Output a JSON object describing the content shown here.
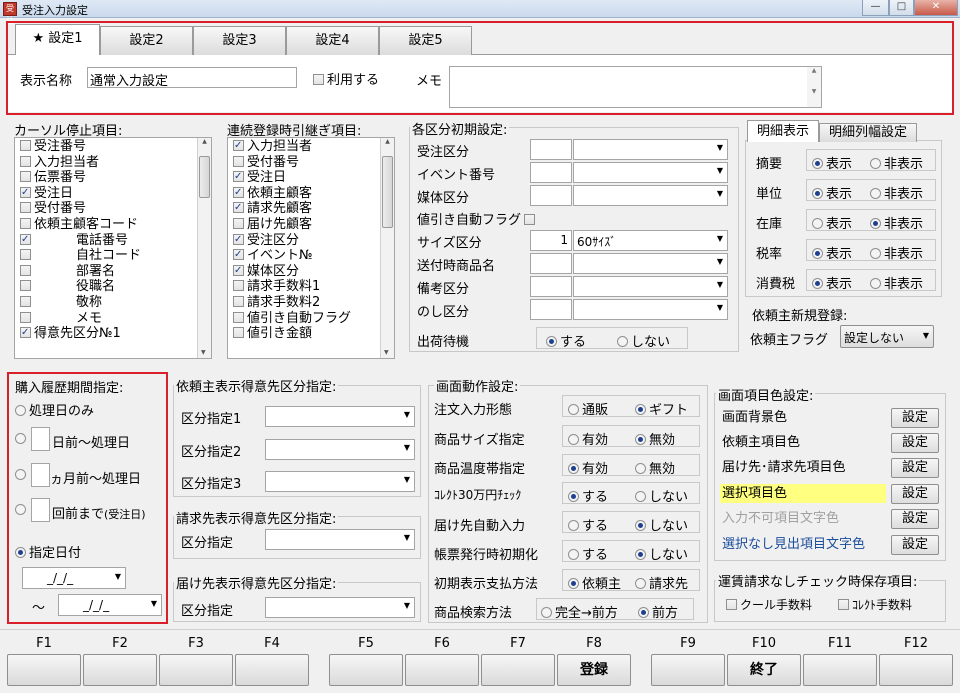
{
  "window": {
    "title": "受注入力設定",
    "app_icon": "受注",
    "buttons": [
      "—",
      "□",
      "✕"
    ]
  },
  "tabs": [
    {
      "label": "★ 設定1"
    },
    {
      "label": "設定2"
    },
    {
      "label": "設定3"
    },
    {
      "label": "設定4"
    },
    {
      "label": "設定5"
    }
  ],
  "settings": {
    "name_label": "表示名称",
    "name_value": "通常入力設定",
    "use_label": "利用する",
    "memo_label": "メモ"
  },
  "cursor": {
    "title": "カーソル停止項目:",
    "items": [
      {
        "label": "受注番号",
        "checked": false
      },
      {
        "label": "入力担当者",
        "checked": false
      },
      {
        "label": "伝票番号",
        "checked": false
      },
      {
        "label": "受注日",
        "checked": true
      },
      {
        "label": "受付番号",
        "checked": false
      },
      {
        "label": "依頼主顧客コード",
        "checked": false
      },
      {
        "label": "電話番号",
        "checked": true
      },
      {
        "label": "自社コード",
        "checked": false
      },
      {
        "label": "部署名",
        "checked": false
      },
      {
        "label": "役職名",
        "checked": false
      },
      {
        "label": "敬称",
        "checked": false
      },
      {
        "label": "メモ",
        "checked": false
      },
      {
        "label": "得意先区分№1",
        "checked": true
      }
    ]
  },
  "carry": {
    "title": "連続登録時引継ぎ項目:",
    "items": [
      {
        "label": "入力担当者",
        "checked": true
      },
      {
        "label": "受付番号",
        "checked": false
      },
      {
        "label": "受注日",
        "checked": true
      },
      {
        "label": "依頼主顧客",
        "checked": true
      },
      {
        "label": "請求先顧客",
        "checked": true
      },
      {
        "label": "届け先顧客",
        "checked": false
      },
      {
        "label": "受注区分",
        "checked": true
      },
      {
        "label": "イベント№",
        "checked": true
      },
      {
        "label": "媒体区分",
        "checked": true
      },
      {
        "label": "請求手数料1",
        "checked": false
      },
      {
        "label": "請求手数料2",
        "checked": false
      },
      {
        "label": "値引き自動フラグ",
        "checked": false
      },
      {
        "label": "値引き金額",
        "checked": false
      }
    ]
  },
  "initial": {
    "title": "各区分初期設定:",
    "rows": [
      {
        "label": "受注区分",
        "code": "",
        "value": ""
      },
      {
        "label": "イベント番号",
        "code": "",
        "value": ""
      },
      {
        "label": "媒体区分",
        "code": "",
        "value": ""
      }
    ],
    "discount_label": "値引き自動フラグ",
    "rows2": [
      {
        "label": "サイズ区分",
        "code": "1",
        "value": "60ｻｲｽﾞ"
      },
      {
        "label": "送付時商品名",
        "code": "",
        "value": ""
      },
      {
        "label": "備考区分",
        "code": "",
        "value": ""
      },
      {
        "label": "のし区分",
        "code": "",
        "value": ""
      }
    ],
    "shipping": {
      "label": "出荷待機",
      "opt1": "する",
      "opt2": "しない"
    }
  },
  "detail": {
    "tab1": "明細表示",
    "tab2": "明細列幅設定",
    "show": "表示",
    "hide": "非表示",
    "rows": [
      {
        "label": "摘要",
        "on": "show"
      },
      {
        "label": "単位",
        "on": "show"
      },
      {
        "label": "在庫",
        "on": "hide"
      },
      {
        "label": "税率",
        "on": "show"
      },
      {
        "label": "消費税",
        "on": "show"
      }
    ]
  },
  "client": {
    "title": "依頼主新規登録:",
    "flag_label": "依頼主フラグ",
    "flag_value": "設定しない"
  },
  "history": {
    "title": "購入履歴期間指定:",
    "opt1": "処理日のみ",
    "opt2": "日前～処理日",
    "opt3": "ヵ月前～処理日",
    "opt4": "回前まで",
    "opt4_note": "(受注日)",
    "opt5": "指定日付",
    "date1": "_/_/_",
    "tilde": "～",
    "date2": "_/_/_"
  },
  "client_cat": {
    "title": "依頼主表示得意先区分指定:",
    "rows": [
      "区分指定1",
      "区分指定2",
      "区分指定3"
    ]
  },
  "billing_cat": {
    "title": "請求先表示得意先区分指定:",
    "row": "区分指定"
  },
  "dest_cat": {
    "title": "届け先表示得意先区分指定:",
    "row": "区分指定"
  },
  "screen": {
    "title": "画面動作設定:",
    "rows": [
      {
        "label": "注文入力形態",
        "a": "通販",
        "b": "ギフト",
        "on": "b"
      },
      {
        "label": "商品サイズ指定",
        "a": "有効",
        "b": "無効",
        "on": "b"
      },
      {
        "label": "商品温度帯指定",
        "a": "有効",
        "b": "無効",
        "on": "a"
      },
      {
        "label": "ｺﾚｸﾄ30万円ﾁｪｯｸ",
        "a": "する",
        "b": "しない",
        "on": "a"
      },
      {
        "label": "届け先自動入力",
        "a": "する",
        "b": "しない",
        "on": "b"
      },
      {
        "label": "帳票発行時初期化",
        "a": "する",
        "b": "しない",
        "on": "b"
      },
      {
        "label": "初期表示支払方法",
        "a": "依頼主",
        "b": "請求先",
        "on": "a"
      },
      {
        "label": "商品検索方法",
        "a": "完全→前方",
        "b": "前方",
        "on": "b"
      }
    ]
  },
  "colors": {
    "title": "画面項目色設定:",
    "btn": "設定",
    "rows": [
      "画面背景色",
      "依頼主項目色",
      "届け先･請求先項目色",
      "選択項目色",
      "入力不可項目文字色",
      "選択なし見出項目文字色"
    ]
  },
  "freight": {
    "title": "運賃請求なしチェック時保存項目:",
    "opt1": "クール手数料",
    "opt2": "ｺﾚｸﾄ手数料"
  },
  "fkeys": [
    {
      "key": "F1",
      "label": ""
    },
    {
      "key": "F2",
      "label": ""
    },
    {
      "key": "F3",
      "label": ""
    },
    {
      "key": "F4",
      "label": ""
    },
    {
      "key": "F5",
      "label": ""
    },
    {
      "key": "F6",
      "label": ""
    },
    {
      "key": "F7",
      "label": ""
    },
    {
      "key": "F8",
      "label": "登録"
    },
    {
      "key": "F9",
      "label": ""
    },
    {
      "key": "F10",
      "label": "終了"
    },
    {
      "key": "F11",
      "label": ""
    },
    {
      "key": "F12",
      "label": ""
    }
  ]
}
